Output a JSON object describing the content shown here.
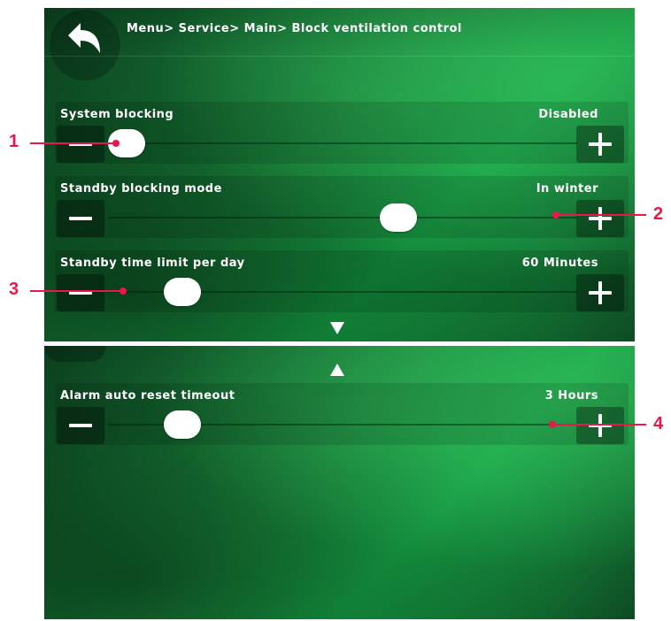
{
  "header": {
    "breadcrumb": "Menu> Service> Main> Block ventilation control",
    "back_icon": "back-arrow-icon"
  },
  "settings": [
    {
      "label": "System blocking",
      "value": "Disabled",
      "level": 0.0
    },
    {
      "label": "Standby blocking mode",
      "value": "In winter",
      "level": 0.63
    },
    {
      "label": "Standby time limit per day",
      "value": "60 Minutes",
      "level": 0.13
    },
    {
      "label": "Alarm auto reset timeout",
      "value": "3 Hours",
      "level": 0.13
    }
  ],
  "callouts": [
    "1",
    "2",
    "3",
    "4"
  ],
  "colors": {
    "accent": "#17a347",
    "callout": "#e8194a"
  }
}
